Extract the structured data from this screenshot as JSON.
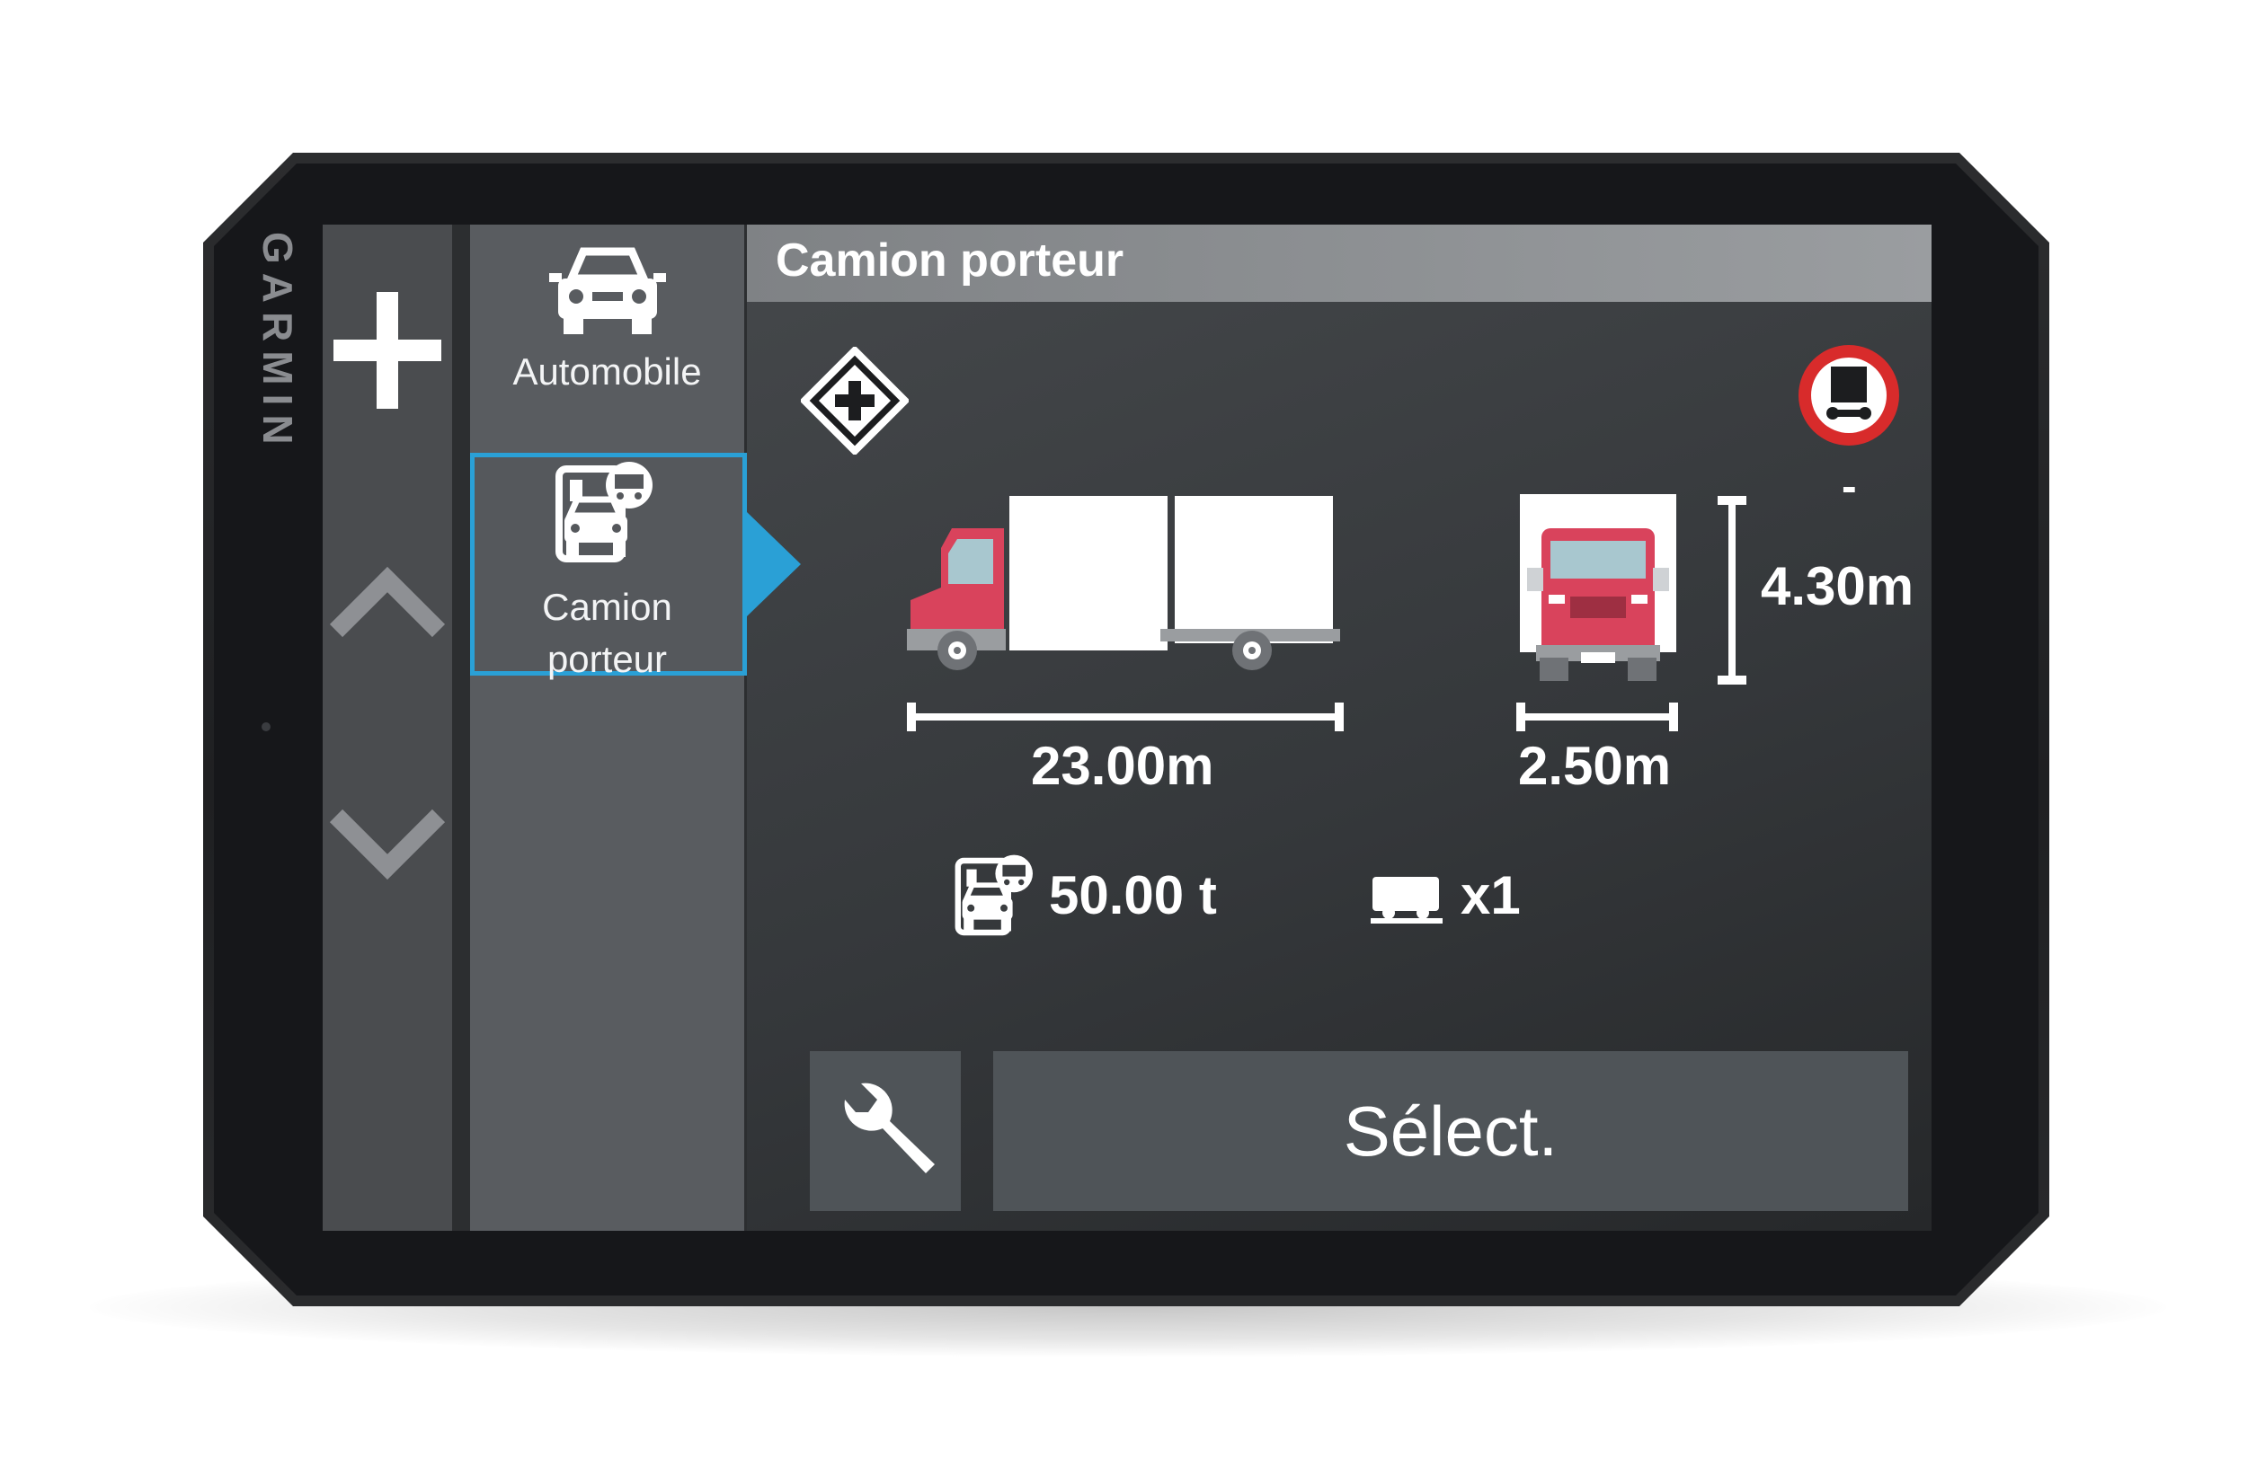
{
  "device": {
    "brand": "GARMIN"
  },
  "nav": {
    "add_icon": "plus-icon",
    "up_icon": "chevron-up-icon",
    "down_icon": "chevron-down-icon"
  },
  "vehicles": {
    "items": [
      {
        "label": "Automobile",
        "icon": "car-icon"
      },
      {
        "label": "Camion\nporteur",
        "label_line1": "Camion",
        "label_line2": "porteur",
        "icon": "truck-profile-icon"
      }
    ],
    "selected_index": 1
  },
  "profile": {
    "title": "Camion porteur",
    "hazmat_icon": "hazmat-diamond-icon",
    "restriction_icon": "no-trucks-sign-icon",
    "restriction_value": "-",
    "length": "23.00m",
    "width": "2.50m",
    "height": "4.30m",
    "weight": "50.00 t",
    "trailers": "x1"
  },
  "actions": {
    "tools_icon": "wrench-icon",
    "select_label": "Sélect."
  },
  "colors": {
    "accent": "#2aa0d6",
    "truck_cab": "#d9435c",
    "restriction_ring": "#d82b2b"
  }
}
